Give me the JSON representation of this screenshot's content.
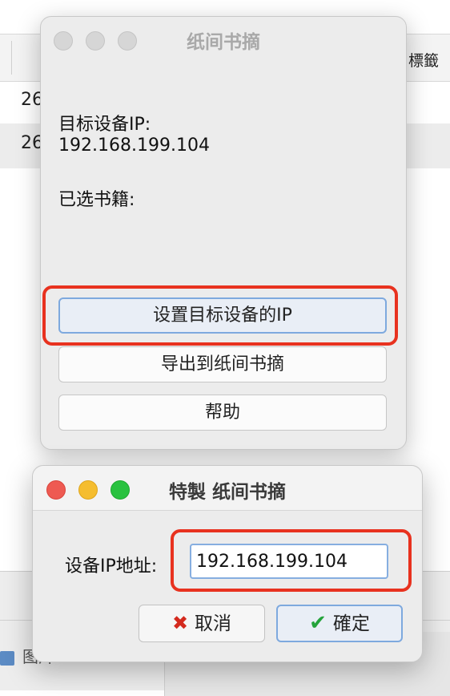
{
  "background": {
    "column_header": "標籤",
    "rows": [
      "26",
      "26"
    ],
    "bottom_item": "图片"
  },
  "dialog1": {
    "title": "纸间书摘",
    "target_ip_label": "目标设备IP:",
    "target_ip_value": "192.168.199.104",
    "selected_books_label": "已选书籍:",
    "buttons": {
      "set_ip": "设置目标设备的IP",
      "export": "导出到纸间书摘",
      "help": "帮助"
    }
  },
  "dialog2": {
    "title": "特製 纸间书摘",
    "ip_label": "设备IP地址:",
    "ip_value": "192.168.199.104",
    "cancel": "取消",
    "ok": "確定"
  },
  "colors": {
    "highlight": "#e8321f",
    "focus_ring": "#7ea9de",
    "close": "#ee5a52",
    "minimize": "#f5bd2f",
    "zoom": "#29c23f"
  }
}
